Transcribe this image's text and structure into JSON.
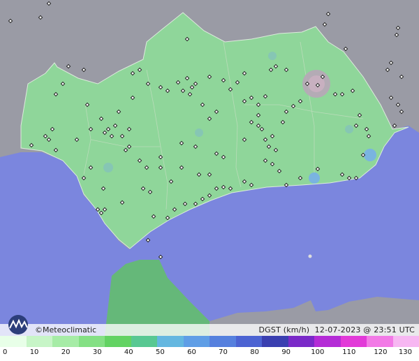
{
  "map": {
    "variable": "DGST (km/h)",
    "datetime": "12-07-2023 @ 23:51 UTC",
    "credit": "©Meteoclimatic",
    "colors": {
      "sea": "#7b86de",
      "land_outside": "#9a9ba5",
      "region": "#8fd69a",
      "region_dark": "#79c383",
      "africa": "#65b879"
    }
  },
  "legend": {
    "ticks": [
      "0",
      "10",
      "20",
      "30",
      "40",
      "50",
      "60",
      "70",
      "80",
      "90",
      "100",
      "110",
      "120",
      "130"
    ],
    "colors": [
      "#e8ffe8",
      "#c7f5c7",
      "#a6eca6",
      "#84e084",
      "#63d363",
      "#58c892",
      "#64b7e0",
      "#5f9ee6",
      "#5680de",
      "#4c63d2",
      "#3a3fb0",
      "#7a2ac8",
      "#b42cd6",
      "#e23ad8",
      "#f27ae6",
      "#f7b7f2"
    ]
  }
}
